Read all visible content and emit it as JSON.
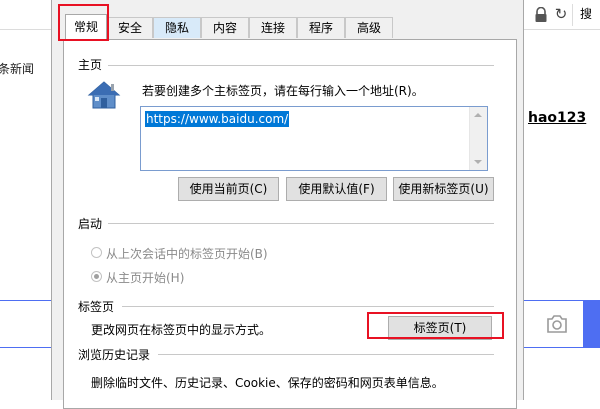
{
  "background_page": {
    "news_text": "条新闻",
    "site_link": "hao123",
    "search_button": "搜",
    "refresh_glyph": "↻"
  },
  "dialog": {
    "tabs": [
      {
        "label": "常规",
        "active": true
      },
      {
        "label": "安全"
      },
      {
        "label": "隐私",
        "hot": true
      },
      {
        "label": "内容"
      },
      {
        "label": "连接"
      },
      {
        "label": "程序"
      },
      {
        "label": "高级"
      }
    ],
    "home_page": {
      "section_title": "主页",
      "description": "若要创建多个主标签页，请在每行输入一个地址(R)。",
      "url_value": "https://www.baidu.com/",
      "buttons": {
        "use_current": "使用当前页(C)",
        "use_default": "使用默认值(F)",
        "use_new_tab": "使用新标签页(U)"
      }
    },
    "startup": {
      "section_title": "启动",
      "option_last_session": "从上次会话中的标签页开始(B)",
      "option_home_page": "从主页开始(H)",
      "selected": "option_home_page"
    },
    "tabs_section": {
      "section_title": "标签页",
      "description": "更改网页在标签页中的显示方式。",
      "button": "标签页(T)"
    },
    "history": {
      "section_title": "浏览历史记录",
      "description": "删除临时文件、历史记录、Cookie、保存的密码和网页表单信息。"
    },
    "highlight_color": "#e81123"
  }
}
